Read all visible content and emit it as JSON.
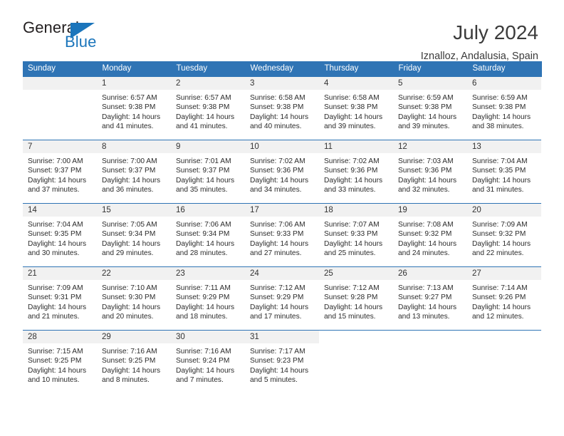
{
  "logo": {
    "word_one": "General",
    "word_two": "Blue",
    "triangle_color": "#1b75bb",
    "text_color": "#231f20"
  },
  "header": {
    "title": "July 2024",
    "subtitle": "Iznalloz, Andalusia, Spain"
  },
  "theme": {
    "header_blue": "#2f74b5",
    "daynum_band": "#f1f1f1",
    "text": "#2b2b2b"
  },
  "calendar": {
    "weekday_headers": [
      "Sunday",
      "Monday",
      "Tuesday",
      "Wednesday",
      "Thursday",
      "Friday",
      "Saturday"
    ],
    "weeks": [
      [
        {
          "day": "",
          "sunrise": "",
          "sunset": "",
          "daylight_line1": "",
          "daylight_line2": ""
        },
        {
          "day": "1",
          "sunrise": "Sunrise: 6:57 AM",
          "sunset": "Sunset: 9:38 PM",
          "daylight_line1": "Daylight: 14 hours",
          "daylight_line2": "and 41 minutes."
        },
        {
          "day": "2",
          "sunrise": "Sunrise: 6:57 AM",
          "sunset": "Sunset: 9:38 PM",
          "daylight_line1": "Daylight: 14 hours",
          "daylight_line2": "and 41 minutes."
        },
        {
          "day": "3",
          "sunrise": "Sunrise: 6:58 AM",
          "sunset": "Sunset: 9:38 PM",
          "daylight_line1": "Daylight: 14 hours",
          "daylight_line2": "and 40 minutes."
        },
        {
          "day": "4",
          "sunrise": "Sunrise: 6:58 AM",
          "sunset": "Sunset: 9:38 PM",
          "daylight_line1": "Daylight: 14 hours",
          "daylight_line2": "and 39 minutes."
        },
        {
          "day": "5",
          "sunrise": "Sunrise: 6:59 AM",
          "sunset": "Sunset: 9:38 PM",
          "daylight_line1": "Daylight: 14 hours",
          "daylight_line2": "and 39 minutes."
        },
        {
          "day": "6",
          "sunrise": "Sunrise: 6:59 AM",
          "sunset": "Sunset: 9:38 PM",
          "daylight_line1": "Daylight: 14 hours",
          "daylight_line2": "and 38 minutes."
        }
      ],
      [
        {
          "day": "7",
          "sunrise": "Sunrise: 7:00 AM",
          "sunset": "Sunset: 9:37 PM",
          "daylight_line1": "Daylight: 14 hours",
          "daylight_line2": "and 37 minutes."
        },
        {
          "day": "8",
          "sunrise": "Sunrise: 7:00 AM",
          "sunset": "Sunset: 9:37 PM",
          "daylight_line1": "Daylight: 14 hours",
          "daylight_line2": "and 36 minutes."
        },
        {
          "day": "9",
          "sunrise": "Sunrise: 7:01 AM",
          "sunset": "Sunset: 9:37 PM",
          "daylight_line1": "Daylight: 14 hours",
          "daylight_line2": "and 35 minutes."
        },
        {
          "day": "10",
          "sunrise": "Sunrise: 7:02 AM",
          "sunset": "Sunset: 9:36 PM",
          "daylight_line1": "Daylight: 14 hours",
          "daylight_line2": "and 34 minutes."
        },
        {
          "day": "11",
          "sunrise": "Sunrise: 7:02 AM",
          "sunset": "Sunset: 9:36 PM",
          "daylight_line1": "Daylight: 14 hours",
          "daylight_line2": "and 33 minutes."
        },
        {
          "day": "12",
          "sunrise": "Sunrise: 7:03 AM",
          "sunset": "Sunset: 9:36 PM",
          "daylight_line1": "Daylight: 14 hours",
          "daylight_line2": "and 32 minutes."
        },
        {
          "day": "13",
          "sunrise": "Sunrise: 7:04 AM",
          "sunset": "Sunset: 9:35 PM",
          "daylight_line1": "Daylight: 14 hours",
          "daylight_line2": "and 31 minutes."
        }
      ],
      [
        {
          "day": "14",
          "sunrise": "Sunrise: 7:04 AM",
          "sunset": "Sunset: 9:35 PM",
          "daylight_line1": "Daylight: 14 hours",
          "daylight_line2": "and 30 minutes."
        },
        {
          "day": "15",
          "sunrise": "Sunrise: 7:05 AM",
          "sunset": "Sunset: 9:34 PM",
          "daylight_line1": "Daylight: 14 hours",
          "daylight_line2": "and 29 minutes."
        },
        {
          "day": "16",
          "sunrise": "Sunrise: 7:06 AM",
          "sunset": "Sunset: 9:34 PM",
          "daylight_line1": "Daylight: 14 hours",
          "daylight_line2": "and 28 minutes."
        },
        {
          "day": "17",
          "sunrise": "Sunrise: 7:06 AM",
          "sunset": "Sunset: 9:33 PM",
          "daylight_line1": "Daylight: 14 hours",
          "daylight_line2": "and 27 minutes."
        },
        {
          "day": "18",
          "sunrise": "Sunrise: 7:07 AM",
          "sunset": "Sunset: 9:33 PM",
          "daylight_line1": "Daylight: 14 hours",
          "daylight_line2": "and 25 minutes."
        },
        {
          "day": "19",
          "sunrise": "Sunrise: 7:08 AM",
          "sunset": "Sunset: 9:32 PM",
          "daylight_line1": "Daylight: 14 hours",
          "daylight_line2": "and 24 minutes."
        },
        {
          "day": "20",
          "sunrise": "Sunrise: 7:09 AM",
          "sunset": "Sunset: 9:32 PM",
          "daylight_line1": "Daylight: 14 hours",
          "daylight_line2": "and 22 minutes."
        }
      ],
      [
        {
          "day": "21",
          "sunrise": "Sunrise: 7:09 AM",
          "sunset": "Sunset: 9:31 PM",
          "daylight_line1": "Daylight: 14 hours",
          "daylight_line2": "and 21 minutes."
        },
        {
          "day": "22",
          "sunrise": "Sunrise: 7:10 AM",
          "sunset": "Sunset: 9:30 PM",
          "daylight_line1": "Daylight: 14 hours",
          "daylight_line2": "and 20 minutes."
        },
        {
          "day": "23",
          "sunrise": "Sunrise: 7:11 AM",
          "sunset": "Sunset: 9:29 PM",
          "daylight_line1": "Daylight: 14 hours",
          "daylight_line2": "and 18 minutes."
        },
        {
          "day": "24",
          "sunrise": "Sunrise: 7:12 AM",
          "sunset": "Sunset: 9:29 PM",
          "daylight_line1": "Daylight: 14 hours",
          "daylight_line2": "and 17 minutes."
        },
        {
          "day": "25",
          "sunrise": "Sunrise: 7:12 AM",
          "sunset": "Sunset: 9:28 PM",
          "daylight_line1": "Daylight: 14 hours",
          "daylight_line2": "and 15 minutes."
        },
        {
          "day": "26",
          "sunrise": "Sunrise: 7:13 AM",
          "sunset": "Sunset: 9:27 PM",
          "daylight_line1": "Daylight: 14 hours",
          "daylight_line2": "and 13 minutes."
        },
        {
          "day": "27",
          "sunrise": "Sunrise: 7:14 AM",
          "sunset": "Sunset: 9:26 PM",
          "daylight_line1": "Daylight: 14 hours",
          "daylight_line2": "and 12 minutes."
        }
      ],
      [
        {
          "day": "28",
          "sunrise": "Sunrise: 7:15 AM",
          "sunset": "Sunset: 9:25 PM",
          "daylight_line1": "Daylight: 14 hours",
          "daylight_line2": "and 10 minutes."
        },
        {
          "day": "29",
          "sunrise": "Sunrise: 7:16 AM",
          "sunset": "Sunset: 9:25 PM",
          "daylight_line1": "Daylight: 14 hours",
          "daylight_line2": "and 8 minutes."
        },
        {
          "day": "30",
          "sunrise": "Sunrise: 7:16 AM",
          "sunset": "Sunset: 9:24 PM",
          "daylight_line1": "Daylight: 14 hours",
          "daylight_line2": "and 7 minutes."
        },
        {
          "day": "31",
          "sunrise": "Sunrise: 7:17 AM",
          "sunset": "Sunset: 9:23 PM",
          "daylight_line1": "Daylight: 14 hours",
          "daylight_line2": "and 5 minutes."
        },
        {
          "day": "",
          "sunrise": "",
          "sunset": "",
          "daylight_line1": "",
          "daylight_line2": ""
        },
        {
          "day": "",
          "sunrise": "",
          "sunset": "",
          "daylight_line1": "",
          "daylight_line2": ""
        },
        {
          "day": "",
          "sunrise": "",
          "sunset": "",
          "daylight_line1": "",
          "daylight_line2": ""
        }
      ]
    ]
  }
}
